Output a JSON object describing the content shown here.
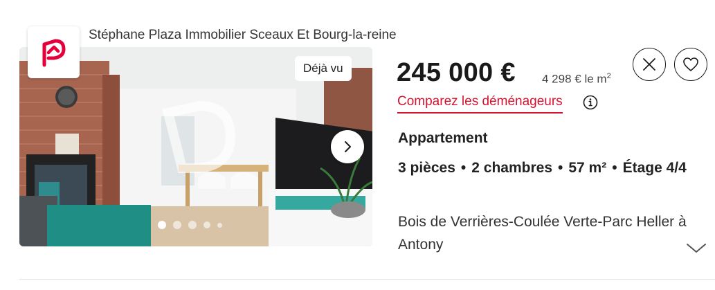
{
  "agency": {
    "name": "Stéphane Plaza Immobilier Sceaux Et Bourg-la-reine",
    "logo_icon": "stephane-plaza-logo-icon",
    "brand_color": "#e4003a"
  },
  "photo": {
    "seen_badge": "Déjà vu",
    "next_icon": "chevron-right-icon",
    "carousel": {
      "total_dots_visible": 5,
      "active_index": 0
    }
  },
  "listing": {
    "price": "245 000 €",
    "price_per_sqm": "4 298 € le m",
    "price_per_sqm_sup": "2",
    "compare_link": "Comparez les déménageurs",
    "type": "Appartement",
    "features": [
      {
        "text": "3 pièces"
      },
      {
        "text": "2 chambres"
      },
      {
        "text": "57 m²"
      },
      {
        "text": "Étage 4/4"
      }
    ],
    "feature_separator": "•",
    "location": "Bois de Verrières-Coulée Verte-Parc Heller à Antony"
  },
  "actions": {
    "close_icon": "close-icon",
    "favorite_icon": "heart-icon",
    "expand_icon": "chevron-down-icon",
    "info_icon": "info-icon"
  },
  "colors": {
    "accent": "#d6122f",
    "text": "#1a1a1a"
  }
}
